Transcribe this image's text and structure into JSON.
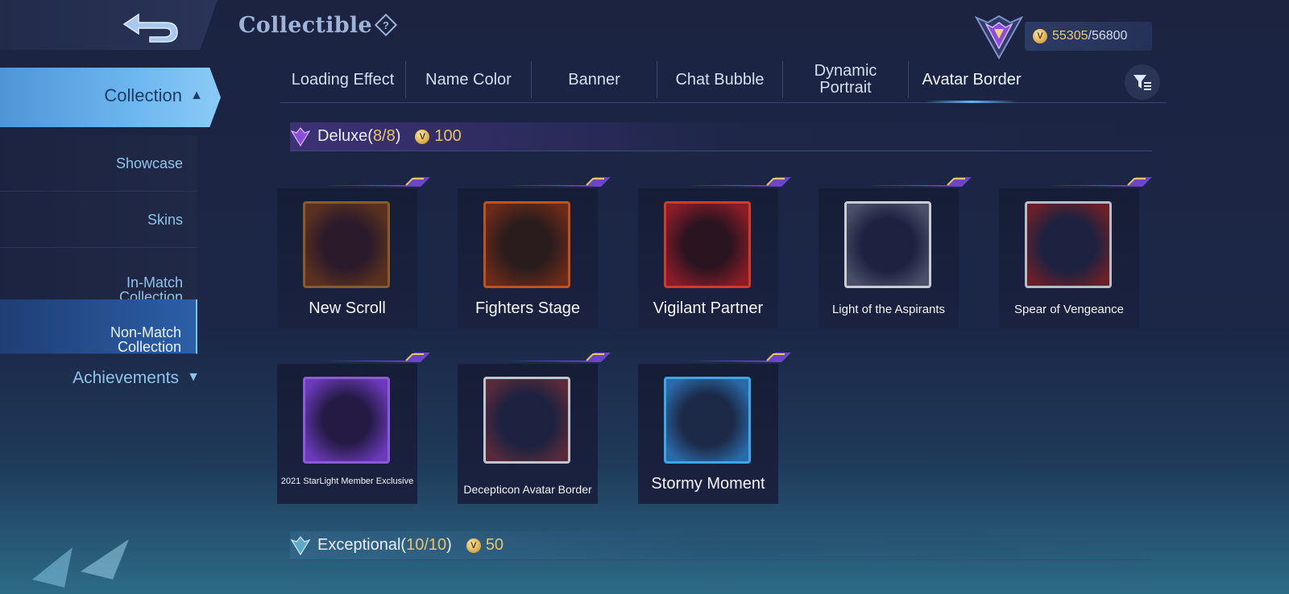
{
  "header": {
    "title": "Collectible",
    "points_current": "55305",
    "points_sep": "/",
    "points_max": "56800"
  },
  "sidebar": {
    "collection_label": "Collection",
    "items": [
      {
        "label": "Showcase"
      },
      {
        "label": "Skins"
      },
      {
        "label": "In-Match\nCollection"
      },
      {
        "label": "Non-Match\nCollection"
      }
    ],
    "achievements_label": "Achievements"
  },
  "tabs": [
    {
      "label": "Loading Effect"
    },
    {
      "label": "Name Color"
    },
    {
      "label": "Banner"
    },
    {
      "label": "Chat Bubble"
    },
    {
      "label": "Dynamic Portrait"
    },
    {
      "label": "Avatar Border"
    }
  ],
  "sections": {
    "deluxe": {
      "name": "Deluxe",
      "open": "(",
      "count": "8/8",
      "close": ")",
      "points": "100"
    },
    "exceptional": {
      "name": "Exceptional",
      "open": "(",
      "count": "10/10",
      "close": ")",
      "points": "50"
    }
  },
  "items": [
    {
      "name": "New Scroll"
    },
    {
      "name": "Fighters Stage"
    },
    {
      "name": "Vigilant Partner"
    },
    {
      "name": "Light of the Aspirants"
    },
    {
      "name": "Spear of Vengeance"
    },
    {
      "name": "2021 StarLight Member Exclusive"
    },
    {
      "name": "Decepticon Avatar Border"
    },
    {
      "name": "Stormy Moment"
    }
  ],
  "colors": {
    "accent_gold": "#e7c56d",
    "accent_blue": "#6cb6ef",
    "accent_purple": "#7a4fd0"
  }
}
